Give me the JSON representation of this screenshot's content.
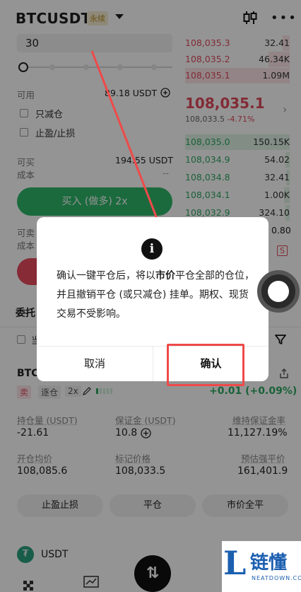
{
  "header": {
    "pair": "BTCUSDT",
    "contract_tag": "永续"
  },
  "order_form": {
    "quantity": "30",
    "available_label": "可用",
    "available_value": "89.18 USDT",
    "reduce_only_label": "只减仓",
    "tp_sl_label": "止盈/止损",
    "buy_openable_label": "可买",
    "buy_openable_value": "194.55 USDT",
    "buy_cost_label": "成本",
    "buy_cost_value": "--",
    "buy_button": "买入 (做多) 2x",
    "sell_openable_label": "可卖",
    "sell_cost_label": "成本"
  },
  "orderbook": {
    "asks": [
      {
        "price": "108,035.3",
        "qty": "32.41"
      },
      {
        "price": "108,035.2",
        "qty": "46.34K"
      },
      {
        "price": "108,035.1",
        "qty": "1.09M"
      }
    ],
    "last_price": "108,035.1",
    "index_price": "108,033.5",
    "change": "-4.71%",
    "bids": [
      {
        "price": "108,035.0",
        "qty": "150.15K"
      },
      {
        "price": "108,034.9",
        "qty": "54.02"
      },
      {
        "price": "108,034.8",
        "qty": "32.41"
      },
      {
        "price": "108,034.1",
        "qty": "1.00K"
      },
      {
        "price": "108,032.9",
        "qty": "324.10"
      }
    ],
    "extra_qty": "0.80",
    "side_tag": "S"
  },
  "orders_tab": {
    "label": "委托",
    "hidden_checkbox_char": "当"
  },
  "position": {
    "title": "BTC",
    "side_tag": "卖",
    "margin_mode": "逐仓",
    "leverage": "2x",
    "pnl": "+0.01 (+0.09%)",
    "size_label": "持仓量 (USDT)",
    "size_value": "-21.61",
    "margin_label": "保证金 (USDT)",
    "margin_value": "10.8",
    "mmr_label": "维持保证金率",
    "mmr_value": "11,127.19%",
    "entry_label": "开仓均价",
    "entry_value": "108,085.6",
    "mark_label": "标记价格",
    "mark_value": "108,033.5",
    "liq_label": "预估强平价",
    "liq_value": "161,401.9",
    "btn_tpsl": "止盈止损",
    "btn_close": "平仓",
    "btn_market_close_all": "市价全平"
  },
  "asset": {
    "coin": "USDT"
  },
  "dialog": {
    "text_1": "确认一键平仓后，将以",
    "text_bold": "市价",
    "text_2": "平仓全部的仓位，并且撤销平仓 (或只减仓) 挂单。期权、现货交易不受影响。",
    "cancel": "取消",
    "confirm": "确认"
  },
  "watermark": {
    "cn": "链懂",
    "en": "NEATDOWN.COM"
  },
  "colors": {
    "buy": "#2fb76a",
    "sell": "#e04a5c",
    "highlight": "#ef4a4a"
  }
}
